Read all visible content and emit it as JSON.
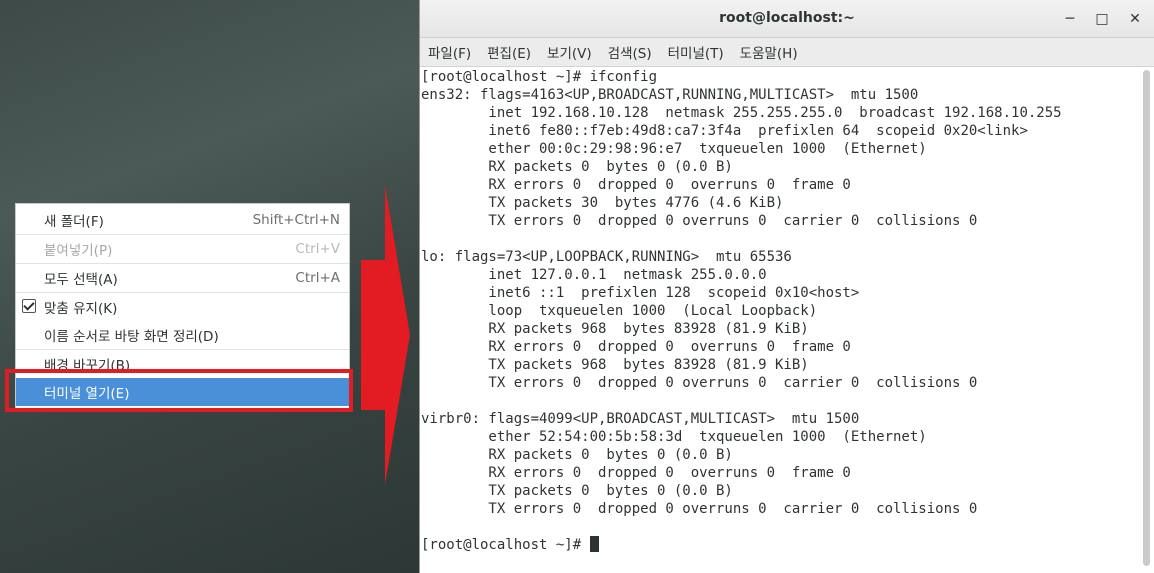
{
  "context_menu": {
    "items": [
      {
        "label": "새 폴더(F)",
        "accel": "Shift+Ctrl+N"
      },
      {
        "label": "붙여넣기(P)",
        "accel": "Ctrl+V"
      },
      {
        "label": "모두 선택(A)",
        "accel": "Ctrl+A"
      },
      {
        "label": "맞춤 유지(K)",
        "accel": ""
      },
      {
        "label": "이름 순서로 바탕 화면 정리(D)",
        "accel": ""
      },
      {
        "label": "배경 바꾸기(B)",
        "accel": ""
      },
      {
        "label": "터미널 열기(E)",
        "accel": ""
      }
    ]
  },
  "terminal": {
    "title": "root@localhost:~",
    "menu": [
      "파일(F)",
      "편집(E)",
      "보기(V)",
      "검색(S)",
      "터미널(T)",
      "도움말(H)"
    ],
    "lines": [
      "[root@localhost ~]# ifconfig",
      "ens32: flags=4163<UP,BROADCAST,RUNNING,MULTICAST>  mtu 1500",
      "        inet 192.168.10.128  netmask 255.255.255.0  broadcast 192.168.10.255",
      "        inet6 fe80::f7eb:49d8:ca7:3f4a  prefixlen 64  scopeid 0x20<link>",
      "        ether 00:0c:29:98:96:e7  txqueuelen 1000  (Ethernet)",
      "        RX packets 0  bytes 0 (0.0 B)",
      "        RX errors 0  dropped 0  overruns 0  frame 0",
      "        TX packets 30  bytes 4776 (4.6 KiB)",
      "        TX errors 0  dropped 0 overruns 0  carrier 0  collisions 0",
      "",
      "lo: flags=73<UP,LOOPBACK,RUNNING>  mtu 65536",
      "        inet 127.0.0.1  netmask 255.0.0.0",
      "        inet6 ::1  prefixlen 128  scopeid 0x10<host>",
      "        loop  txqueuelen 1000  (Local Loopback)",
      "        RX packets 968  bytes 83928 (81.9 KiB)",
      "        RX errors 0  dropped 0  overruns 0  frame 0",
      "        TX packets 968  bytes 83928 (81.9 KiB)",
      "        TX errors 0  dropped 0 overruns 0  carrier 0  collisions 0",
      "",
      "virbr0: flags=4099<UP,BROADCAST,MULTICAST>  mtu 1500",
      "        ether 52:54:00:5b:58:3d  txqueuelen 1000  (Ethernet)",
      "        RX packets 0  bytes 0 (0.0 B)",
      "        RX errors 0  dropped 0  overruns 0  frame 0",
      "        TX packets 0  bytes 0 (0.0 B)",
      "        TX errors 0  dropped 0 overruns 0  carrier 0  collisions 0",
      "",
      "[root@localhost ~]# "
    ]
  },
  "colors": {
    "highlight_red": "#e31b23",
    "selection_blue": "#4a90d9"
  }
}
